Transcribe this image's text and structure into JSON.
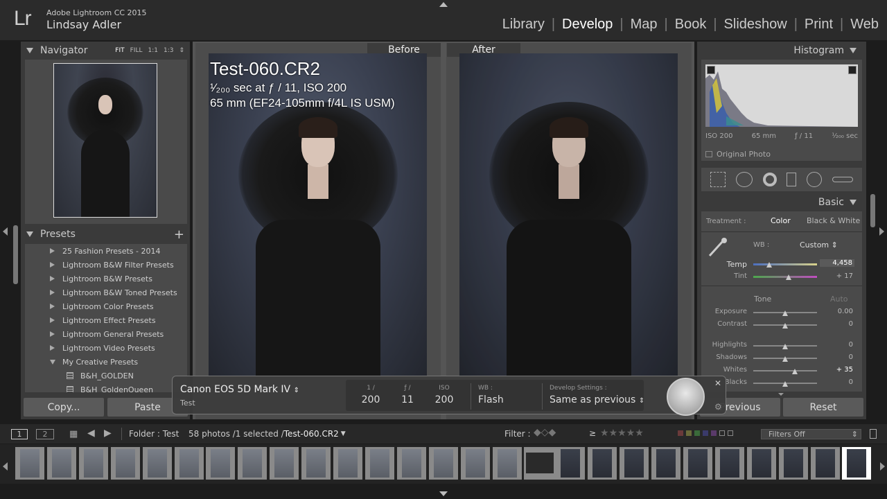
{
  "app": {
    "logo": "Lr",
    "name": "Adobe Lightroom CC 2015",
    "user": "Lindsay Adler"
  },
  "modules": [
    "Library",
    "Develop",
    "Map",
    "Book",
    "Slideshow",
    "Print",
    "Web"
  ],
  "active_module": "Develop",
  "navigator": {
    "title": "Navigator",
    "zoom": [
      "FIT",
      "FILL",
      "1:1",
      "1:3"
    ]
  },
  "presets": {
    "title": "Presets",
    "add_label": "+",
    "items": [
      {
        "label": "25 Fashion Presets - 2014",
        "type": "folder"
      },
      {
        "label": "Lightroom B&W Filter Presets",
        "type": "folder"
      },
      {
        "label": "Lightroom B&W Presets",
        "type": "folder"
      },
      {
        "label": "Lightroom B&W Toned Presets",
        "type": "folder"
      },
      {
        "label": "Lightroom Color Presets",
        "type": "folder"
      },
      {
        "label": "Lightroom Effect Presets",
        "type": "folder"
      },
      {
        "label": "Lightroom General Presets",
        "type": "folder"
      },
      {
        "label": "Lightroom Video Presets",
        "type": "folder"
      },
      {
        "label": "My Creative Presets",
        "type": "open"
      },
      {
        "label": "B&H_GOLDEN",
        "type": "preset"
      },
      {
        "label": "B&H_GoldenQueen",
        "type": "preset"
      }
    ]
  },
  "left_buttons": {
    "copy": "Copy...",
    "paste": "Paste"
  },
  "compare": {
    "before": "Before",
    "after": "After"
  },
  "photo_info": {
    "filename": "Test-060.CR2",
    "exposure_line": "¹⁄₂₀₀ sec at ƒ / 11, ISO 200",
    "lens_line": "65 mm (EF24-105mm f/4L IS USM)"
  },
  "histogram": {
    "title": "Histogram",
    "iso": "ISO 200",
    "focal": "65 mm",
    "aperture": "ƒ / 11",
    "shutter": "¹⁄₂₀₀ sec",
    "original_photo": "Original Photo"
  },
  "basic": {
    "title": "Basic",
    "treatment_label": "Treatment :",
    "treatment_color": "Color",
    "treatment_bw": "Black & White",
    "wb_label": "WB :",
    "wb_value": "Custom",
    "temp_label": "Temp",
    "temp_value": "4,458",
    "temp_level": 0.25,
    "tint_label": "Tint",
    "tint_value": "+ 17",
    "tint_level": 0.55,
    "tone_label": "Tone",
    "auto_label": "Auto",
    "sliders": [
      {
        "label": "Exposure",
        "value": "0.00",
        "level": 0.5
      },
      {
        "label": "Contrast",
        "value": "0",
        "level": 0.5
      },
      {
        "label": "Highlights",
        "value": "0",
        "level": 0.5
      },
      {
        "label": "Shadows",
        "value": "0",
        "level": 0.5
      },
      {
        "label": "Whites",
        "value": "+ 35",
        "level": 0.65
      },
      {
        "label": "Blacks",
        "value": "0",
        "level": 0.5
      }
    ]
  },
  "right_buttons": {
    "previous": "Previous",
    "reset": "Reset"
  },
  "hud": {
    "camera": "Canon EOS 5D Mark IV",
    "subtitle": "Test",
    "shutter_title": "1 /",
    "shutter_value": "200",
    "aperture_title": "ƒ /",
    "aperture_value": "11",
    "iso_title": "ISO",
    "iso_value": "200",
    "wb_title": "WB :",
    "wb_value": "Flash",
    "dev_title": "Develop Settings :",
    "dev_value": "Same as previous"
  },
  "filmbar": {
    "page1": "1",
    "page2": "2",
    "folder_label": "Folder : Test",
    "count": "58 photos /1 selected /",
    "selected_file": "Test-060.CR2",
    "filter_label": "Filter :",
    "filters_off": "Filters Off",
    "gte": "≥"
  },
  "filmstrip_count": 27
}
